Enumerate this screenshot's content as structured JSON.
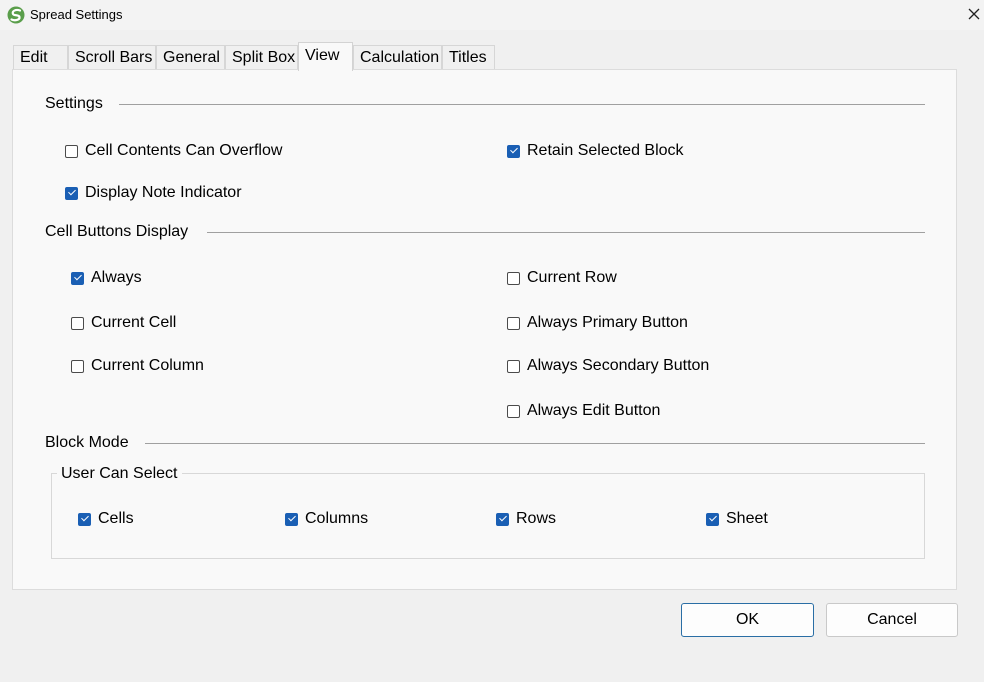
{
  "window": {
    "title": "Spread Settings",
    "app_icon": "spread-logo-icon",
    "close_icon": "close-icon"
  },
  "tabs": [
    {
      "label": "Edit",
      "active": false
    },
    {
      "label": "Scroll Bars",
      "active": false
    },
    {
      "label": "General",
      "active": false
    },
    {
      "label": "Split Box",
      "active": false
    },
    {
      "label": "View",
      "active": true
    },
    {
      "label": "Calculation",
      "active": false
    },
    {
      "label": "Titles",
      "active": false
    }
  ],
  "settings": {
    "heading": "Settings",
    "cell_contents_overflow": {
      "label": "Cell Contents Can Overflow",
      "checked": false
    },
    "retain_selected_block": {
      "label": "Retain Selected Block",
      "checked": true
    },
    "display_note_indicator": {
      "label": "Display Note Indicator",
      "checked": true
    }
  },
  "cell_buttons": {
    "heading": "Cell Buttons Display",
    "always": {
      "label": "Always",
      "checked": true
    },
    "current_cell": {
      "label": "Current Cell",
      "checked": false
    },
    "current_column": {
      "label": "Current Column",
      "checked": false
    },
    "current_row": {
      "label": "Current Row",
      "checked": false
    },
    "always_primary": {
      "label": "Always Primary Button",
      "checked": false
    },
    "always_secondary": {
      "label": "Always Secondary Button",
      "checked": false
    },
    "always_edit": {
      "label": "Always Edit Button",
      "checked": false
    }
  },
  "block_mode": {
    "heading": "Block Mode",
    "group_label": "User Can Select",
    "cells": {
      "label": "Cells",
      "checked": true
    },
    "columns": {
      "label": "Columns",
      "checked": true
    },
    "rows": {
      "label": "Rows",
      "checked": true
    },
    "sheet": {
      "label": "Sheet",
      "checked": true
    }
  },
  "buttons": {
    "ok": "OK",
    "cancel": "Cancel"
  },
  "colors": {
    "accent": "#1a5fb4",
    "logo_green": "#5a9e4b"
  }
}
